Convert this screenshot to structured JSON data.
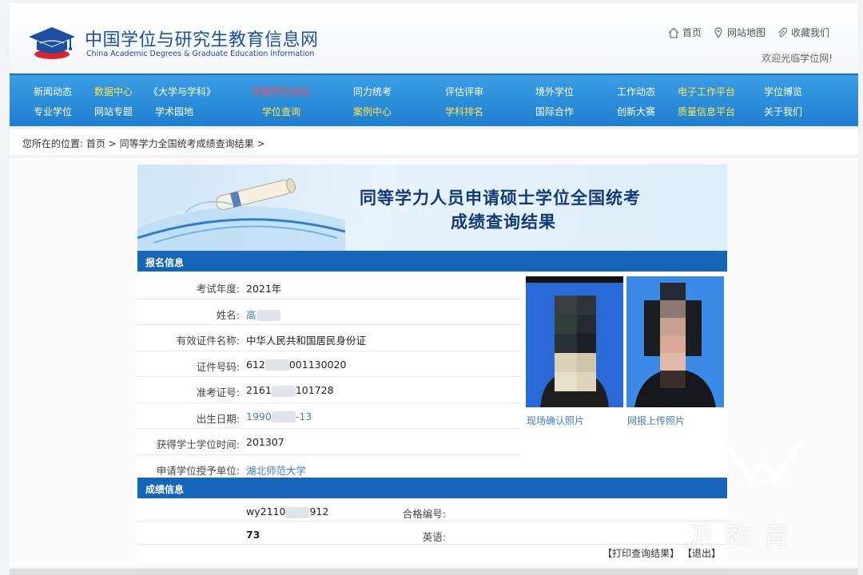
{
  "header": {
    "site_name_cn": "中国学位与研究生教育信息网",
    "site_name_en": "China Academic Degrees & Graduate Education Information",
    "links": [
      {
        "label": "首页",
        "icon": "home-icon"
      },
      {
        "label": "网站地图",
        "icon": "map-pin-icon"
      },
      {
        "label": "收藏我们",
        "icon": "paperclip-icon"
      }
    ],
    "welcome": "欢迎光临学位网!"
  },
  "nav": {
    "row1": [
      {
        "label": "新闻动态",
        "style": "normal"
      },
      {
        "label": "数据中心",
        "style": "hl"
      },
      {
        "label": "《大学与学科》",
        "style": "normal"
      },
      {
        "label": "中国学位论坛",
        "style": "red"
      },
      {
        "label": "同力统考",
        "style": "normal"
      },
      {
        "label": "评估评审",
        "style": "normal"
      },
      {
        "label": "境外学位",
        "style": "normal"
      },
      {
        "label": "工作动态",
        "style": "normal"
      },
      {
        "label": "电子工作平台",
        "style": "hl"
      },
      {
        "label": "学位博览",
        "style": "normal"
      }
    ],
    "row2": [
      {
        "label": "专业学位",
        "style": "normal"
      },
      {
        "label": "网站专题",
        "style": "normal"
      },
      {
        "label": "学术园地",
        "style": "normal"
      },
      {
        "label": "学位查询",
        "style": "hl"
      },
      {
        "label": "案例中心",
        "style": "hl"
      },
      {
        "label": "学科排名",
        "style": "hl"
      },
      {
        "label": "国际合作",
        "style": "normal"
      },
      {
        "label": "创新大赛",
        "style": "normal"
      },
      {
        "label": "质量信息平台",
        "style": "hl"
      },
      {
        "label": "关于我们",
        "style": "normal"
      }
    ]
  },
  "breadcrumb": {
    "prefix": "您所在的位置:",
    "home": "首页",
    "sep": ">",
    "current": "同等学力全国统考成绩查询结果",
    "tail": ">"
  },
  "banner": {
    "title_line1": "同等学力人员申请硕士学位全国统考",
    "title_line2": "成绩查询结果"
  },
  "registration": {
    "section_title": "报名信息",
    "fields": [
      {
        "label": "考试年度:",
        "value": "2021年",
        "blue": false
      },
      {
        "label": "姓名:",
        "value": "高",
        "blue": true
      },
      {
        "label": "有效证件名称:",
        "value": "中华人民共和国居民身份证",
        "blue": false
      },
      {
        "label": "证件号码:",
        "value": "612",
        "value_tail": "001130020",
        "blue": false
      },
      {
        "label": "准考证号:",
        "value": "2161",
        "value_tail": "101728",
        "blue": false
      },
      {
        "label": "出生日期:",
        "value": "1990",
        "value_tail": "-13",
        "blue": true
      },
      {
        "label": "获得学士学位时间:",
        "value": "201307",
        "blue": false
      },
      {
        "label": "申请学位授予单位:",
        "value": "湖北师范大学",
        "blue": true
      }
    ],
    "photo_onsite_caption": "现场确认照片",
    "photo_upload_caption": "网报上传照片"
  },
  "scores": {
    "section_title": "成绩信息",
    "fields": [
      {
        "label": "合格编号:",
        "value": "wy2110",
        "value_tail": "912"
      },
      {
        "label": "英语:",
        "value": "73"
      }
    ]
  },
  "actions": {
    "print": "【打印查询结果】",
    "exit": "【退出】"
  },
  "watermark": {
    "text": "源教育"
  },
  "colors": {
    "brand_blue": "#1b4fa2",
    "nav_blue": "#2d8fdc",
    "section_bar": "#1565b8",
    "link_blue": "#3f7fc9",
    "nav_highlight": "#ffe44d",
    "nav_red": "#ff4d4d"
  }
}
